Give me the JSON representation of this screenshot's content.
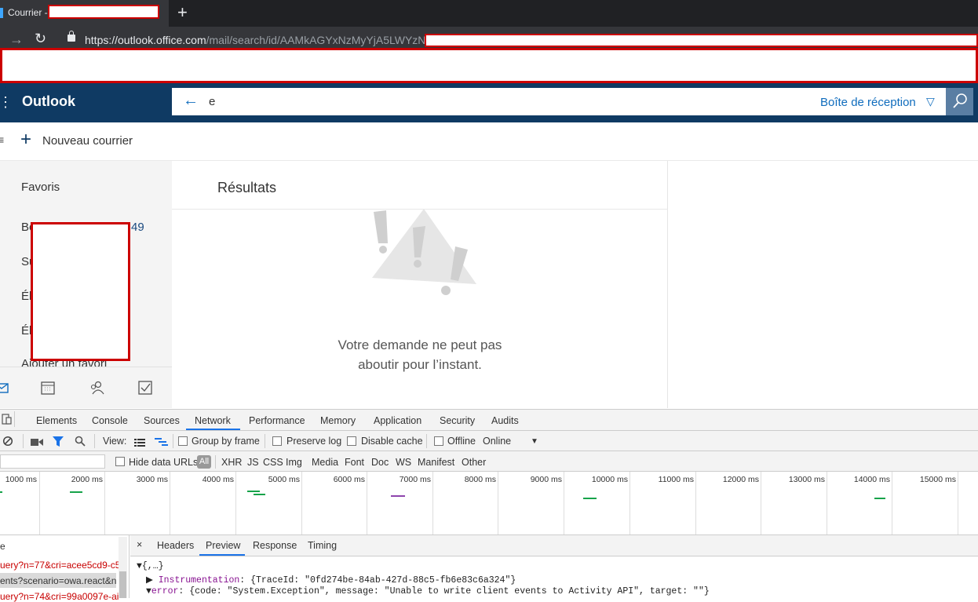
{
  "browser": {
    "tab_title": "Courrier -",
    "new_tab_symbol": "+",
    "url_host": "https://outlook.office.com",
    "url_path": "/mail/search/id/AAMkAGYxNzMyYjA5LWYzN"
  },
  "outlook": {
    "brand": "Outlook",
    "search_query": "e",
    "search_scope": "Boîte de réception",
    "new_mail_label": "Nouveau courrier",
    "folders": {
      "favorites": "Favoris",
      "item1_prefix": "Bo",
      "item1_count": "49",
      "item2_prefix": "Su",
      "item3_prefix": "Él",
      "item4_prefix": "Él",
      "add_favorite": "Ajouter un favori"
    },
    "results_title": "Résultats",
    "error_line1": "Votre demande ne peut pas",
    "error_line2": "aboutir pour l’instant."
  },
  "devtools": {
    "tabs": [
      "Elements",
      "Console",
      "Sources",
      "Network",
      "Performance",
      "Memory",
      "Application",
      "Security",
      "Audits"
    ],
    "active_tab": "Network",
    "toolbar": {
      "view_label": "View:",
      "group_by_frame": "Group by frame",
      "preserve_log": "Preserve log",
      "disable_cache": "Disable cache",
      "offline": "Offline",
      "throttle": "Online"
    },
    "filters": {
      "hide_data_urls": "Hide data URLs",
      "types": [
        "All",
        "XHR",
        "JS",
        "CSS",
        "Img",
        "Media",
        "Font",
        "Doc",
        "WS",
        "Manifest",
        "Other"
      ]
    },
    "timeline_labels": [
      "1000 ms",
      "2000 ms",
      "3000 ms",
      "4000 ms",
      "5000 ms",
      "6000 ms",
      "7000 ms",
      "8000 ms",
      "9000 ms",
      "10000 ms",
      "11000 ms",
      "12000 ms",
      "13000 ms",
      "14000 ms",
      "15000 ms"
    ],
    "requests": {
      "header": "e",
      "rows": [
        "uery?n=77&cri=acee5cd9-c5",
        "ents?scenario=owa.react&n",
        "uery?n=74&cri=99a0097e-ai"
      ]
    },
    "preview_tabs": [
      "Headers",
      "Preview",
      "Response",
      "Timing"
    ],
    "preview_close": "×",
    "json_root": "{,…}",
    "instrumentation_key": "Instrumentation",
    "instrumentation_val": "{TraceId: \"0fd274be-84ab-427d-88c5-fb6e83c6a324\"}",
    "error_key": "error",
    "error_val": "{code: \"System.Exception\", message: \"Unable to write client events to Activity API\", target: \"\"}"
  }
}
